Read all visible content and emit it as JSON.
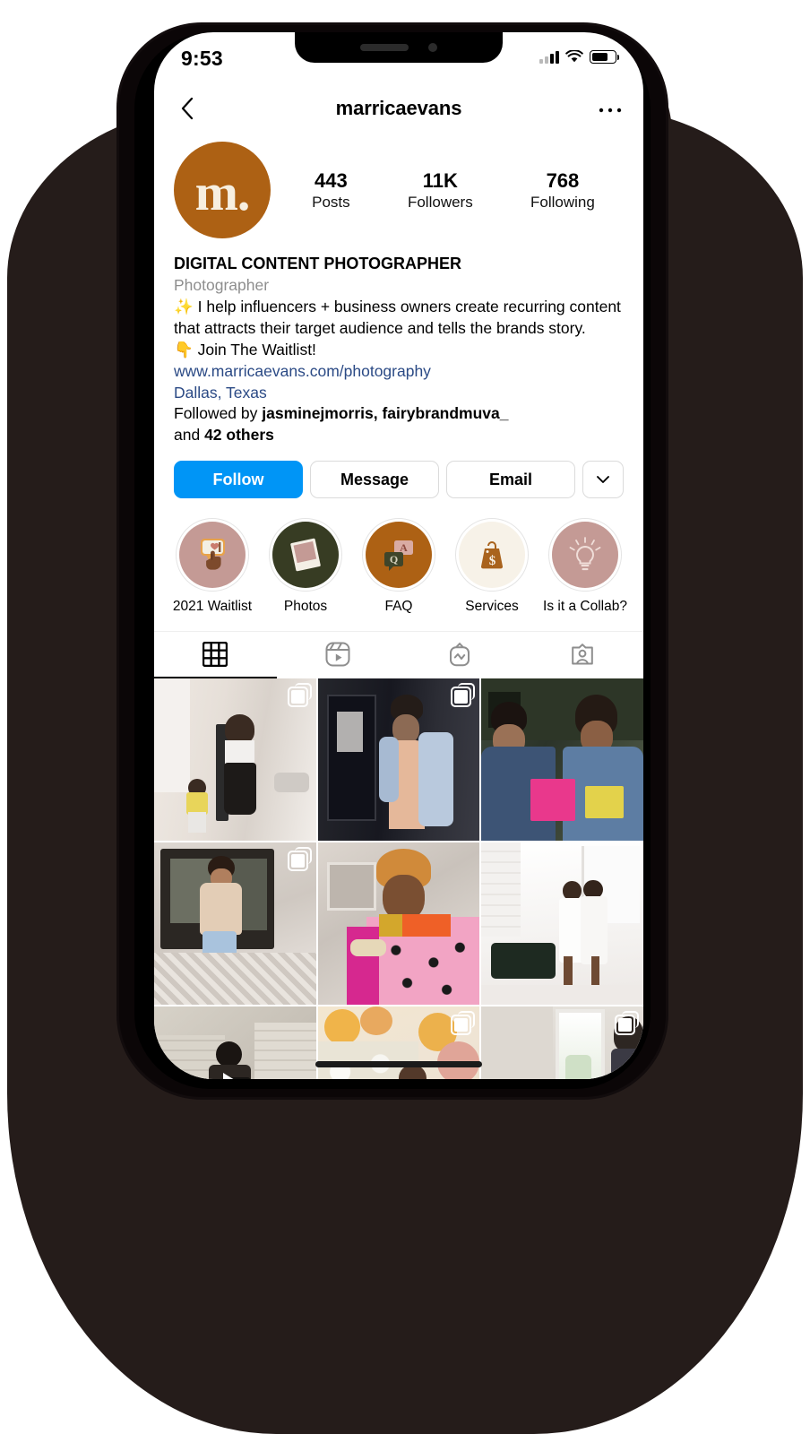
{
  "status_bar": {
    "time": "9:53",
    "signal_icon": "cellular-signal-icon",
    "wifi_icon": "wifi-icon",
    "battery_icon": "battery-icon"
  },
  "nav": {
    "back_icon": "chevron-left-icon",
    "title": "marricaevans",
    "more_icon": "ellipsis-icon"
  },
  "profile": {
    "avatar_mark": "m.",
    "avatar_color": "#ad6114",
    "stats": [
      {
        "value": "443",
        "label": "Posts"
      },
      {
        "value": "11K",
        "label": "Followers"
      },
      {
        "value": "768",
        "label": "Following"
      }
    ]
  },
  "bio": {
    "display_name": "DIGITAL CONTENT PHOTOGRAPHER",
    "category": "Photographer",
    "line_1": "✨ I help influencers + business owners create recurring content that attracts their target audience and tells the brands story.",
    "line_2": "👇 Join The Waitlist!",
    "website": "www.marricaevans.com/photography",
    "location": "Dallas, Texas",
    "followed_by_prefix": "Followed by ",
    "followed_by_names": "jasminejmorris, fairybrandmuva_",
    "followed_by_mid": "and ",
    "followed_by_count": "42 others"
  },
  "actions": {
    "follow": "Follow",
    "follow_color": "#0095f6",
    "message": "Message",
    "email": "Email",
    "chevron_icon": "chevron-down-icon"
  },
  "highlights": [
    {
      "label": "2021 Waitlist",
      "icon": "hand-tap-like-icon",
      "bg": "#c49a95"
    },
    {
      "label": "Photos",
      "icon": "polaroid-photo-icon",
      "bg": "#373c23"
    },
    {
      "label": "FAQ",
      "icon": "question-answer-bubbles-icon",
      "bg": "#ad6114"
    },
    {
      "label": "Services",
      "icon": "price-tag-dollar-icon",
      "bg": "#f7f2e8"
    },
    {
      "label": "Is it a Collab?",
      "icon": "lightbulb-idea-icon",
      "bg": "#c49a95"
    }
  ],
  "tabs": [
    {
      "name": "grid",
      "icon": "grid-icon",
      "active": true
    },
    {
      "name": "reels",
      "icon": "reels-icon",
      "active": false
    },
    {
      "name": "igtv",
      "icon": "igtv-icon",
      "active": false
    },
    {
      "name": "tagged",
      "icon": "tagged-user-icon",
      "active": false
    }
  ],
  "grid_posts": [
    {
      "alt": "woman and child walking on city sidewalk",
      "badge": "carousel",
      "overlay": "none"
    },
    {
      "alt": "woman in peach dress and denim jacket",
      "badge": "carousel",
      "overlay": "none"
    },
    {
      "alt": "two women in denim holding folders",
      "badge": "none",
      "overlay": "none"
    },
    {
      "alt": "woman in tan blouse by storefront door",
      "badge": "carousel",
      "overlay": "none"
    },
    {
      "alt": "smiling woman in patterned dress",
      "badge": "none",
      "overlay": "none"
    },
    {
      "alt": "two women in white in bright studio",
      "badge": "none",
      "overlay": "none"
    },
    {
      "alt": "photographer with camera in city",
      "badge": "none",
      "overlay": "play"
    },
    {
      "alt": "couple at floral balloon backdrop",
      "badge": "carousel",
      "overlay": "none"
    },
    {
      "alt": "woman by window in white room",
      "badge": "carousel",
      "overlay": "none"
    }
  ],
  "home_indicator": "home-indicator"
}
